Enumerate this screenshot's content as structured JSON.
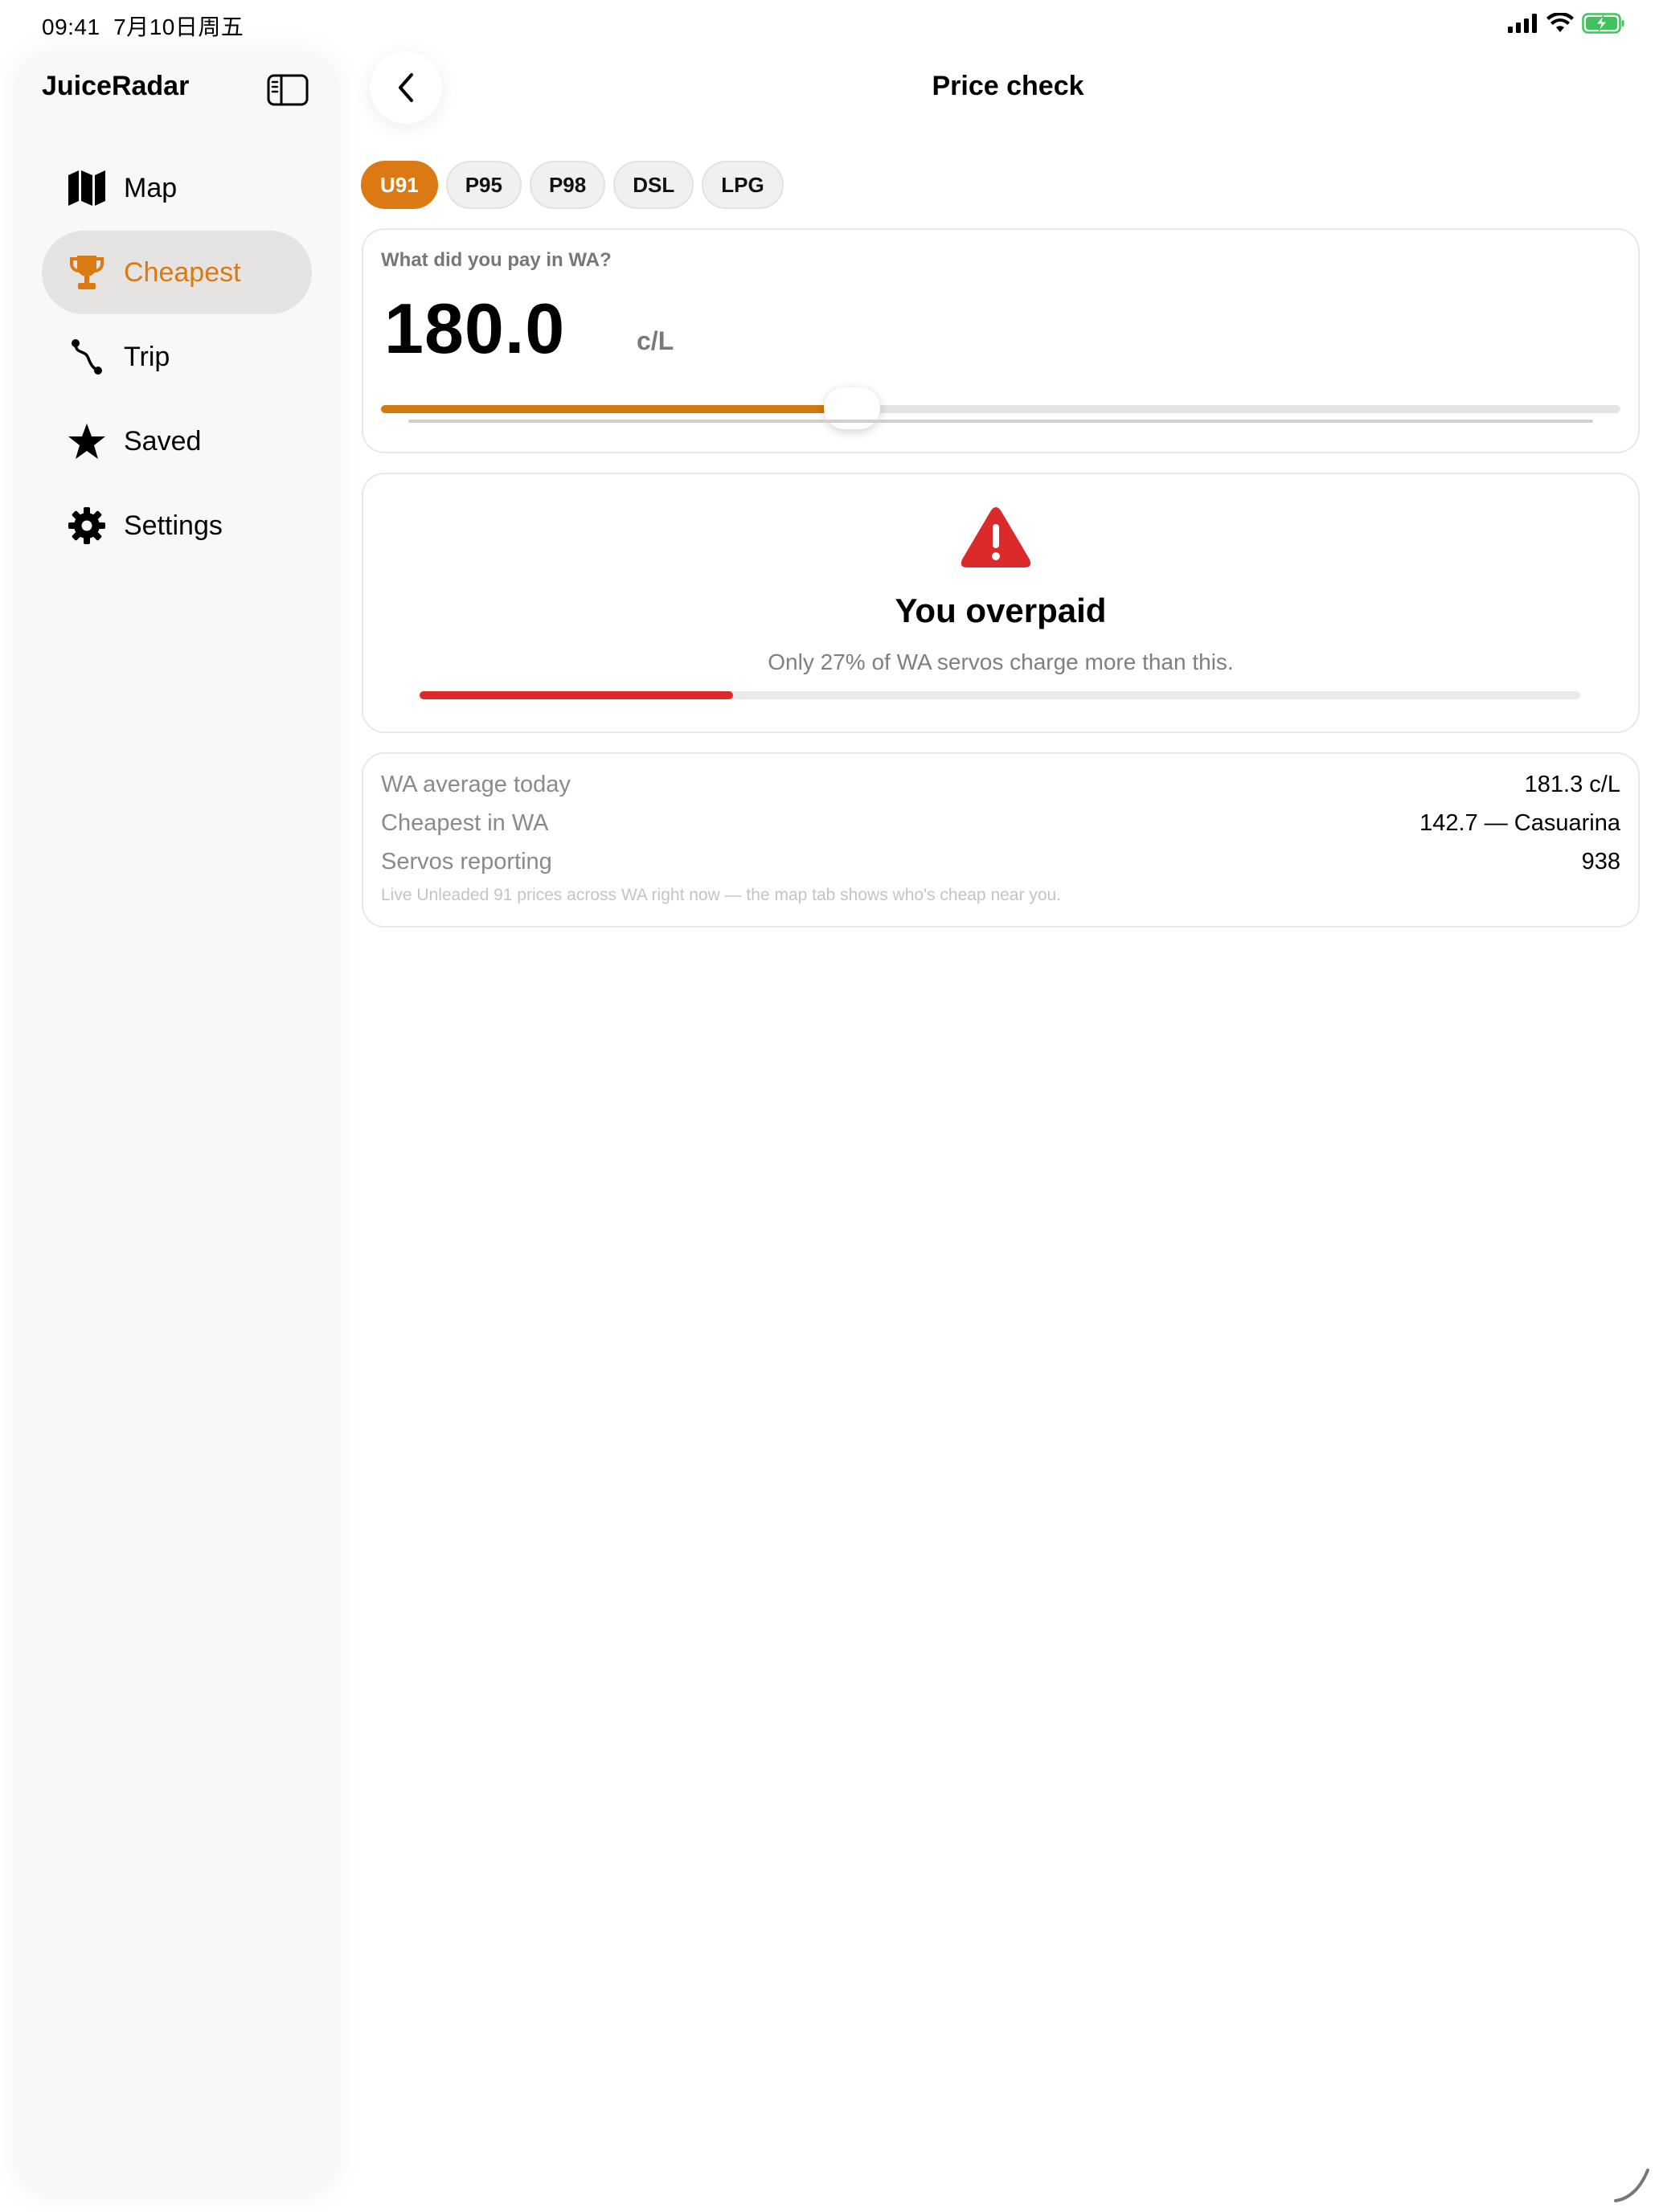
{
  "status_bar": {
    "time": "09:41",
    "date": "7月10日周五"
  },
  "sidebar": {
    "app_title": "JuiceRadar",
    "items": [
      {
        "label": "Map",
        "icon": "map-icon"
      },
      {
        "label": "Cheapest",
        "icon": "trophy-icon",
        "active": true
      },
      {
        "label": "Trip",
        "icon": "route-icon"
      },
      {
        "label": "Saved",
        "icon": "star-icon"
      },
      {
        "label": "Settings",
        "icon": "gear-icon"
      }
    ]
  },
  "header": {
    "title": "Price check"
  },
  "fuel_types": {
    "selected": "U91",
    "options": [
      "U91",
      "P95",
      "P98",
      "DSL",
      "LPG"
    ]
  },
  "price_input": {
    "question": "What did you pay in WA?",
    "value": "180.0",
    "unit": "c/L",
    "slider_fraction": 0.38
  },
  "verdict": {
    "title": "You overpaid",
    "subtitle": "Only 27% of WA servos charge more than this.",
    "percentile_fraction": 0.27
  },
  "stats": {
    "rows": [
      {
        "label": "WA average today",
        "value": "181.3 c/L"
      },
      {
        "label": "Cheapest in WA",
        "value": "142.7 — Casuarina"
      },
      {
        "label": "Servos reporting",
        "value": "938"
      }
    ],
    "footnote": "Live Unleaded 91 prices across WA right now — the map tab shows who's cheap near you."
  },
  "colors": {
    "accent": "#db7a12",
    "danger": "#dc2a2a",
    "battery": "#3fc35a"
  }
}
